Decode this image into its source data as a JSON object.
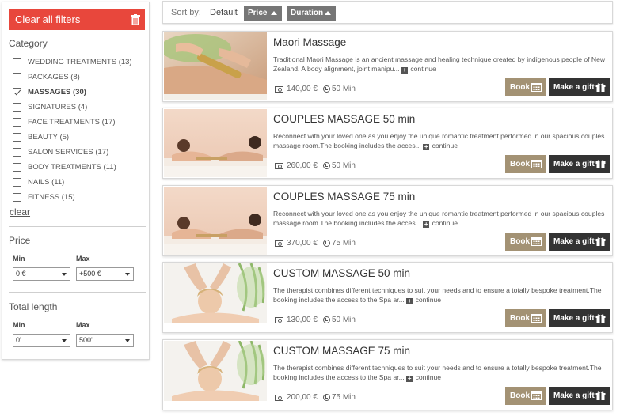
{
  "sidebar": {
    "clear_all_label": "Clear all filters",
    "category_title": "Category",
    "categories": [
      {
        "label": "WEDDING TREATMENTS (13)",
        "checked": false
      },
      {
        "label": "PACKAGES (8)",
        "checked": false
      },
      {
        "label": "MASSAGES (30)",
        "checked": true
      },
      {
        "label": "SIGNATURES (4)",
        "checked": false
      },
      {
        "label": "FACE TREATMENTS (17)",
        "checked": false
      },
      {
        "label": "BEAUTY (5)",
        "checked": false
      },
      {
        "label": "SALON SERVICES (17)",
        "checked": false
      },
      {
        "label": "BODY TREATMENTS (11)",
        "checked": false
      },
      {
        "label": "NAILS (11)",
        "checked": false
      },
      {
        "label": "FITNESS (15)",
        "checked": false
      }
    ],
    "clear_label": "clear",
    "price": {
      "title": "Price",
      "min_label": "Min",
      "max_label": "Max",
      "min_value": "0 €",
      "max_value": "+500 €"
    },
    "length": {
      "title": "Total length",
      "min_label": "Min",
      "max_label": "Max",
      "min_value": "0'",
      "max_value": "500'"
    }
  },
  "sort": {
    "label": "Sort by:",
    "default_label": "Default",
    "price_label": "Price",
    "duration_label": "Duration"
  },
  "colors": {
    "clear_button": "#e8473c",
    "book_button": "#a39274",
    "gift_button": "#333333",
    "sort_button": "#767676"
  },
  "cards": [
    {
      "title": "Maori Massage",
      "description": "Traditional Maori Massage is an ancient massage and healing technique created by indigenous people of New Zealand. A body alignment, joint manipu... ",
      "continue_label": "continue",
      "price": "140,00 €",
      "duration": "50 Min",
      "book_label": "Book",
      "gift_label": "Make a gift",
      "image": "maori"
    },
    {
      "title": "COUPLES MASSAGE 50 min",
      "description": "Reconnect with your loved one as you enjoy the unique romantic treatment performed in our spacious couples massage room.The booking includes the acces... ",
      "continue_label": "continue",
      "price": "260,00 €",
      "duration": "50 Min",
      "book_label": "Book",
      "gift_label": "Make a gift",
      "image": "couples"
    },
    {
      "title": "COUPLES MASSAGE 75 min",
      "description": "Reconnect with your loved one as you enjoy the unique romantic treatment performed in our spacious couples massage room.The booking includes the acces... ",
      "continue_label": "continue",
      "price": "370,00 €",
      "duration": "75 Min",
      "book_label": "Book",
      "gift_label": "Make a gift",
      "image": "couples"
    },
    {
      "title": "CUSTOM MASSAGE 50 min",
      "description": "The therapist combines different techniques to suit your needs and to ensure a totally bespoke treatment.The booking includes the access to the Spa ar... ",
      "continue_label": "continue",
      "price": "130,00 €",
      "duration": "50 Min",
      "book_label": "Book",
      "gift_label": "Make a gift",
      "image": "custom"
    },
    {
      "title": "CUSTOM MASSAGE 75 min",
      "description": "The therapist combines different techniques to suit your needs and to ensure a totally bespoke treatment.The booking includes the access to the Spa ar... ",
      "continue_label": "continue",
      "price": "200,00 €",
      "duration": "75 Min",
      "book_label": "Book",
      "gift_label": "Make a gift",
      "image": "custom"
    }
  ]
}
